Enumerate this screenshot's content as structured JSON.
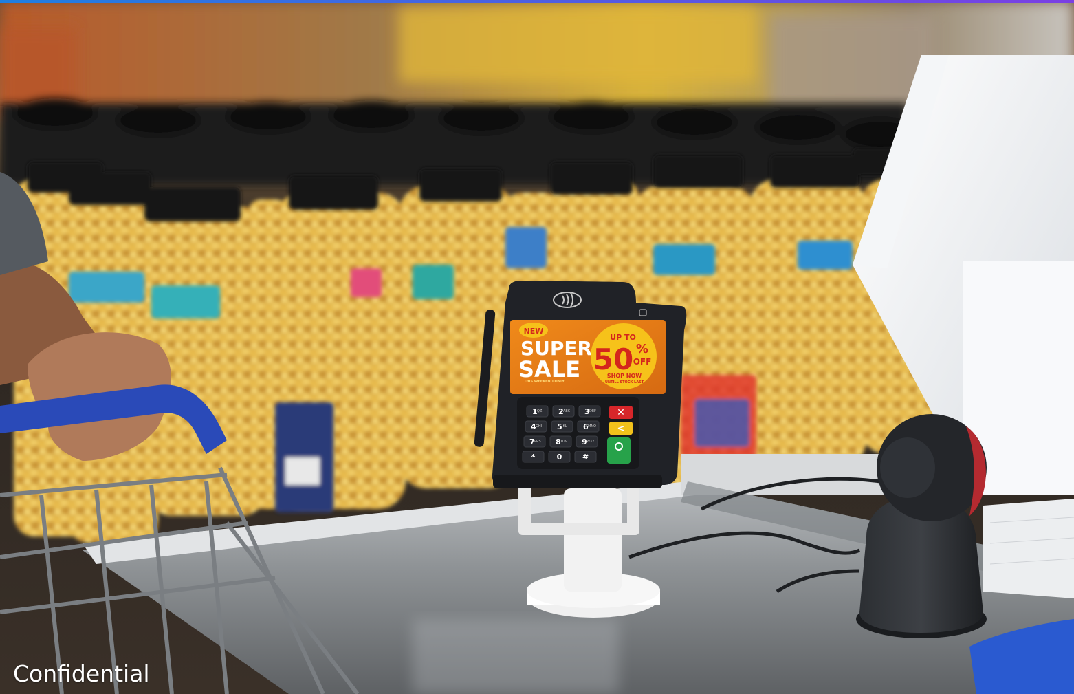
{
  "footer": {
    "confidential_label": "Confidential"
  },
  "terminal": {
    "screen": {
      "badge": "NEW",
      "headline_line1": "SUPER",
      "headline_line2": "SALE",
      "fine_print": "THIS WEEKEND ONLY",
      "up_to": "UP TO",
      "percent_value": "50",
      "percent_sign": "%",
      "off": "OFF",
      "shop_now": "SHOP NOW",
      "until_stock": "UNTILL STOCK LAST"
    },
    "keypad": [
      {
        "main": "1",
        "sub": "QZ"
      },
      {
        "main": "2",
        "sub": "ABC"
      },
      {
        "main": "3",
        "sub": "DEF"
      },
      {
        "main": "4",
        "sub": "GHI"
      },
      {
        "main": "5",
        "sub": "JKL"
      },
      {
        "main": "6",
        "sub": "MNO"
      },
      {
        "main": "7",
        "sub": "PRS"
      },
      {
        "main": "8",
        "sub": "TUV"
      },
      {
        "main": "9",
        "sub": "WXY"
      },
      {
        "main": "*",
        "sub": ""
      },
      {
        "main": "0",
        "sub": ""
      },
      {
        "main": "#",
        "sub": ""
      }
    ],
    "function_keys": [
      "cancel",
      "clear",
      "enter"
    ],
    "icons": [
      "contactless-icon",
      "card-slot-icon"
    ]
  },
  "colors": {
    "accent_bar_start": "#1f7fe0",
    "accent_bar_end": "#7b3fe4",
    "screen_orange": "#e58a1a",
    "screen_yellow": "#f6c21a",
    "sale_red": "#d4261c",
    "key_red": "#d7262a",
    "key_yellow": "#f2c21b",
    "key_green": "#27a24a"
  }
}
